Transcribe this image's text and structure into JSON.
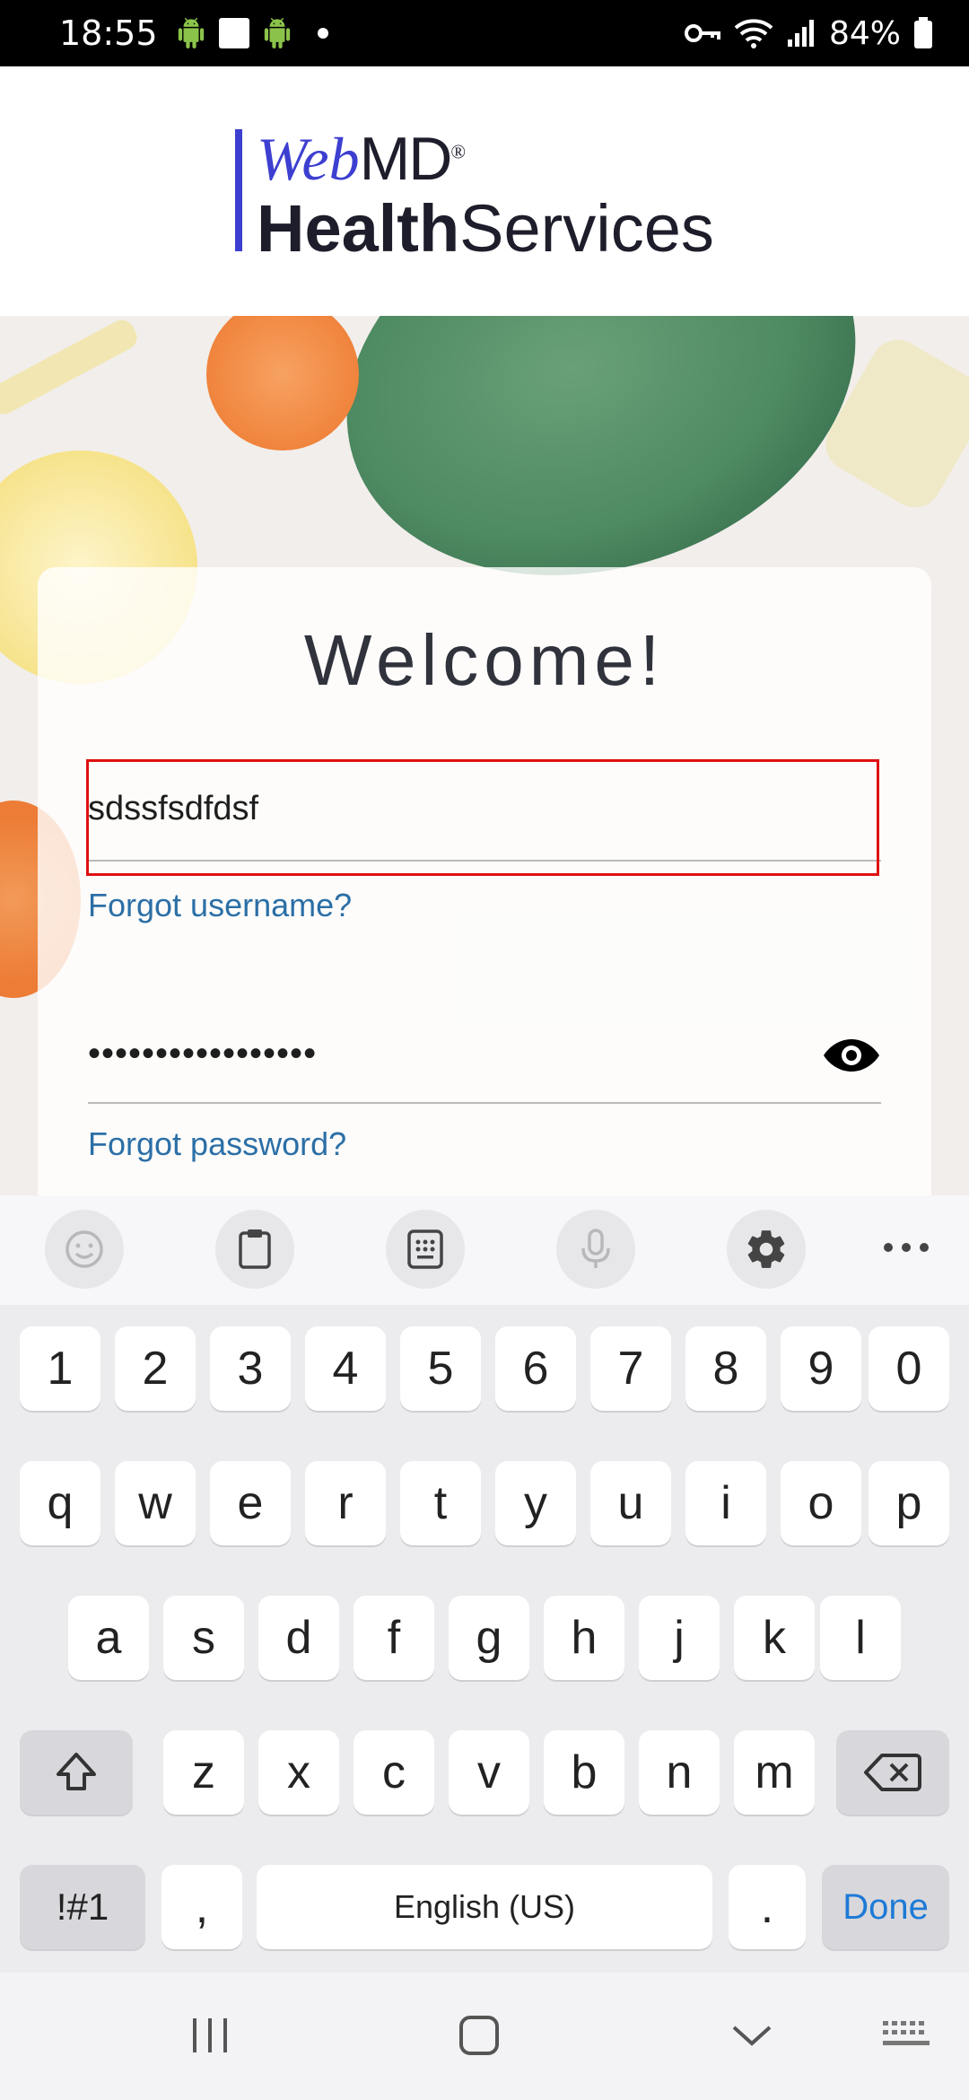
{
  "status_bar": {
    "time": "18:55",
    "battery_text": "84%",
    "icons": [
      "android-icon",
      "android-icon",
      "notification-dot-icon",
      "key-icon",
      "wifi-icon",
      "signal-icon",
      "battery-icon"
    ]
  },
  "logo": {
    "web": "Web",
    "md": "MD",
    "registered": "®",
    "health": "Health",
    "services": "Services"
  },
  "login": {
    "title": "Welcome!",
    "username_value": "sdssfsdfdsf",
    "forgot_username": "Forgot username?",
    "password_value": "•••••••••••••••••",
    "forgot_password": "Forgot password?"
  },
  "keyboard": {
    "toolbar": [
      "emoji-icon",
      "clipboard-icon",
      "keypad-icon",
      "microphone-icon",
      "settings-icon",
      "more-icon"
    ],
    "row_numbers": [
      "1",
      "2",
      "3",
      "4",
      "5",
      "6",
      "7",
      "8",
      "9",
      "0"
    ],
    "row_q": [
      "q",
      "w",
      "e",
      "r",
      "t",
      "y",
      "u",
      "i",
      "o",
      "p"
    ],
    "row_a": [
      "a",
      "s",
      "d",
      "f",
      "g",
      "h",
      "j",
      "k",
      "l"
    ],
    "row_z": [
      "z",
      "x",
      "c",
      "v",
      "b",
      "n",
      "m"
    ],
    "symbols_label": "!#1",
    "comma_label": ",",
    "space_label": "English (US)",
    "period_label": ".",
    "done_label": "Done"
  },
  "colors": {
    "accent_link": "#2c6fa6",
    "logo_blue": "#3d3fd0",
    "highlight_red": "#e01010",
    "done_blue": "#1e7ad6"
  }
}
